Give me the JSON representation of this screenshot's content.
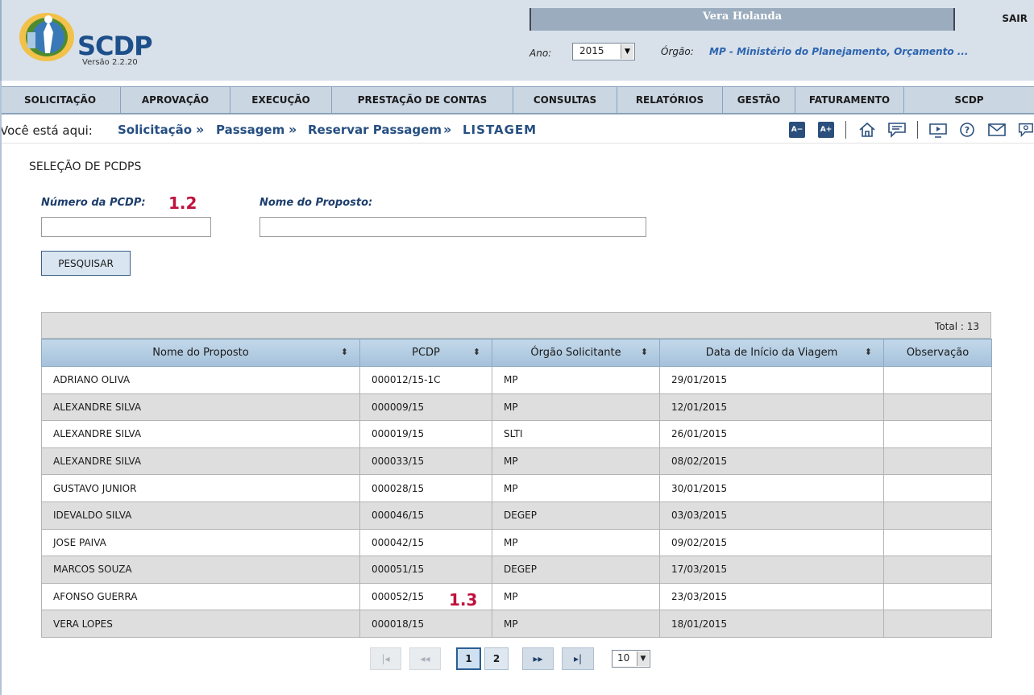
{
  "header": {
    "logo_text": "SCDP",
    "version": "Versão 2.2.20",
    "user_name": "Vera Holanda",
    "logout_label": "SAIR",
    "year_label": "Ano:",
    "year_value": "2015",
    "org_label": "Órgão:",
    "org_value": "MP - Ministério do Planejamento, Orçamento ..."
  },
  "nav": {
    "items": [
      {
        "label": "SOLICITAÇÃO"
      },
      {
        "label": "APROVAÇÃO"
      },
      {
        "label": "EXECUÇÃO"
      },
      {
        "label": "PRESTAÇÃO DE CONTAS"
      },
      {
        "label": "CONSULTAS"
      },
      {
        "label": "RELATÓRIOS"
      },
      {
        "label": "GESTÃO"
      },
      {
        "label": "FATURAMENTO"
      },
      {
        "label": "SCDP"
      }
    ]
  },
  "breadcrumb": {
    "prefix": "Você está aqui:",
    "items": [
      "Solicitação",
      "Passagem",
      "Reservar Passagem"
    ],
    "current": "LISTAGEM"
  },
  "toolbar": {
    "font_decrease": "A−",
    "font_increase": "A+",
    "icons": [
      "home-icon",
      "chat-icon",
      "video-icon",
      "help-icon",
      "mail-icon",
      "support-icon"
    ]
  },
  "form": {
    "section_title": "SELEÇÃO DE PCDPS",
    "pcdp_label": "Número da PCDP:",
    "pcdp_value": "",
    "annotation_1": "1.2",
    "name_label": "Nome do Proposto:",
    "name_value": "",
    "search_button": "PESQUISAR"
  },
  "table": {
    "total": "Total : 13",
    "columns": [
      "Nome do Proposto",
      "PCDP",
      "Órgão Solicitante",
      "Data de Início da Viagem",
      "Observação"
    ],
    "rows": [
      [
        "ADRIANO OLIVA",
        "000012/15-1C",
        "MP",
        "29/01/2015",
        ""
      ],
      [
        "ALEXANDRE SILVA",
        "000009/15",
        "MP",
        "12/01/2015",
        ""
      ],
      [
        "ALEXANDRE SILVA",
        "000019/15",
        "SLTI",
        "26/01/2015",
        ""
      ],
      [
        "ALEXANDRE SILVA",
        "000033/15",
        "MP",
        "08/02/2015",
        ""
      ],
      [
        "GUSTAVO JUNIOR",
        "000028/15",
        "MP",
        "30/01/2015",
        ""
      ],
      [
        "IDEVALDO SILVA",
        "000046/15",
        "DEGEP",
        "03/03/2015",
        ""
      ],
      [
        "JOSE PAIVA",
        "000042/15",
        "MP",
        "09/02/2015",
        ""
      ],
      [
        "MARCOS SOUZA",
        "000051/15",
        "DEGEP",
        "17/03/2015",
        ""
      ],
      [
        "AFONSO GUERRA",
        "000052/15",
        "MP",
        "23/03/2015",
        ""
      ],
      [
        "VERA LOPES",
        "000018/15",
        "MP",
        "18/01/2015",
        ""
      ]
    ],
    "annotation_2": "1.3"
  },
  "pager": {
    "first": "|◂",
    "prev": "◂◂",
    "pages": [
      "1",
      "2"
    ],
    "current_page": "1",
    "next": "▸▸",
    "last": "▸|",
    "rows_per_page": "10"
  }
}
